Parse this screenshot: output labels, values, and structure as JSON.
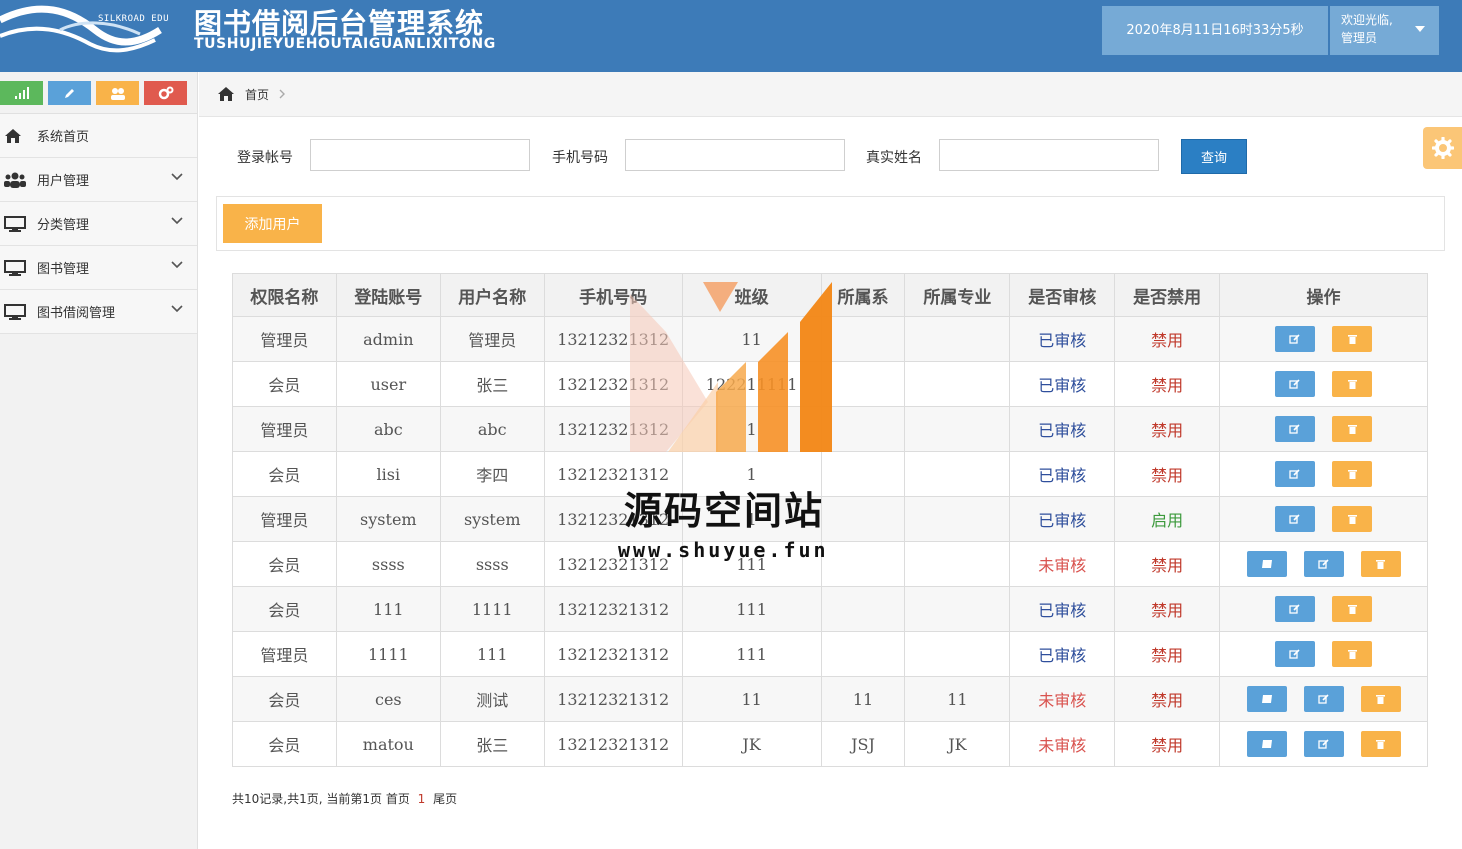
{
  "header": {
    "logo_text": "SILKROAD EDU",
    "title": "图书借阅后台管理系统",
    "subtitle": "TUSHUJIEYUEHOUTAIGUANLIXITONG",
    "datetime": "2020年8月11日16时33分5秒",
    "welcome": "欢迎光临,",
    "role": "管理员"
  },
  "sidebar": {
    "shortcuts": [
      {
        "icon": "signal-icon",
        "color": "#5cb85c"
      },
      {
        "icon": "pencil-icon",
        "color": "#5aa1d9"
      },
      {
        "icon": "users-icon",
        "color": "#f9b349"
      },
      {
        "icon": "cogs-icon",
        "color": "#e05a4e"
      }
    ],
    "items": [
      {
        "label": "系统首页",
        "icon": "home-icon"
      },
      {
        "label": "用户管理",
        "icon": "users-icon"
      },
      {
        "label": "分类管理",
        "icon": "monitor-icon"
      },
      {
        "label": "图书管理",
        "icon": "monitor-icon"
      },
      {
        "label": "图书借阅管理",
        "icon": "monitor-icon"
      }
    ]
  },
  "breadcrumb": {
    "home": "首页"
  },
  "search": {
    "account_label": "登录帐号",
    "account_value": "",
    "phone_label": "手机号码",
    "phone_value": "",
    "realname_label": "真实姓名",
    "realname_value": "",
    "button": "查询"
  },
  "toolbar": {
    "add_label": "添加用户"
  },
  "table": {
    "headers": [
      "权限名称",
      "登陆账号",
      "用户名称",
      "手机号码",
      "班级",
      "所属系",
      "所属专业",
      "是否审核",
      "是否禁用",
      "操作"
    ],
    "rows": [
      {
        "role": "管理员",
        "account": "admin",
        "name": "管理员",
        "phone": "13212321312",
        "cls": "11",
        "dept": "",
        "major": "",
        "audit": "已审核",
        "audit_ok": true,
        "ban": "禁用",
        "ban_on": false,
        "extra": false
      },
      {
        "role": "会员",
        "account": "user",
        "name": "张三",
        "phone": "13212321312",
        "cls": "122211111",
        "dept": "",
        "major": "",
        "audit": "已审核",
        "audit_ok": true,
        "ban": "禁用",
        "ban_on": false,
        "extra": false
      },
      {
        "role": "管理员",
        "account": "abc",
        "name": "abc",
        "phone": "13212321312",
        "cls": "1",
        "dept": "",
        "major": "",
        "audit": "已审核",
        "audit_ok": true,
        "ban": "禁用",
        "ban_on": false,
        "extra": false
      },
      {
        "role": "会员",
        "account": "lisi",
        "name": "李四",
        "phone": "13212321312",
        "cls": "1",
        "dept": "",
        "major": "",
        "audit": "已审核",
        "audit_ok": true,
        "ban": "禁用",
        "ban_on": false,
        "extra": false
      },
      {
        "role": "管理员",
        "account": "system",
        "name": "system",
        "phone": "13212321312",
        "cls": "1",
        "dept": "",
        "major": "",
        "audit": "已审核",
        "audit_ok": true,
        "ban": "启用",
        "ban_on": true,
        "extra": false
      },
      {
        "role": "会员",
        "account": "ssss",
        "name": "ssss",
        "phone": "13212321312",
        "cls": "111",
        "dept": "",
        "major": "",
        "audit": "未审核",
        "audit_ok": false,
        "ban": "禁用",
        "ban_on": false,
        "extra": true
      },
      {
        "role": "会员",
        "account": "111",
        "name": "1111",
        "phone": "13212321312",
        "cls": "111",
        "dept": "",
        "major": "",
        "audit": "已审核",
        "audit_ok": true,
        "ban": "禁用",
        "ban_on": false,
        "extra": false
      },
      {
        "role": "管理员",
        "account": "1111",
        "name": "111",
        "phone": "13212321312",
        "cls": "111",
        "dept": "",
        "major": "",
        "audit": "已审核",
        "audit_ok": true,
        "ban": "禁用",
        "ban_on": false,
        "extra": false
      },
      {
        "role": "会员",
        "account": "ces",
        "name": "测试",
        "phone": "13212321312",
        "cls": "11",
        "dept": "11",
        "major": "11",
        "audit": "未审核",
        "audit_ok": false,
        "ban": "禁用",
        "ban_on": false,
        "extra": true
      },
      {
        "role": "会员",
        "account": "matou",
        "name": "张三",
        "phone": "13212321312",
        "cls": "JK",
        "dept": "JSJ",
        "major": "JK",
        "audit": "未审核",
        "audit_ok": false,
        "ban": "禁用",
        "ban_on": false,
        "extra": true
      }
    ]
  },
  "pager": {
    "summary": "共10记录,共1页, 当前第1页",
    "first": "首页",
    "current": "1",
    "last": "尾页"
  },
  "watermark": {
    "title": "源码空间站",
    "url": "www.shuyue.fun"
  }
}
